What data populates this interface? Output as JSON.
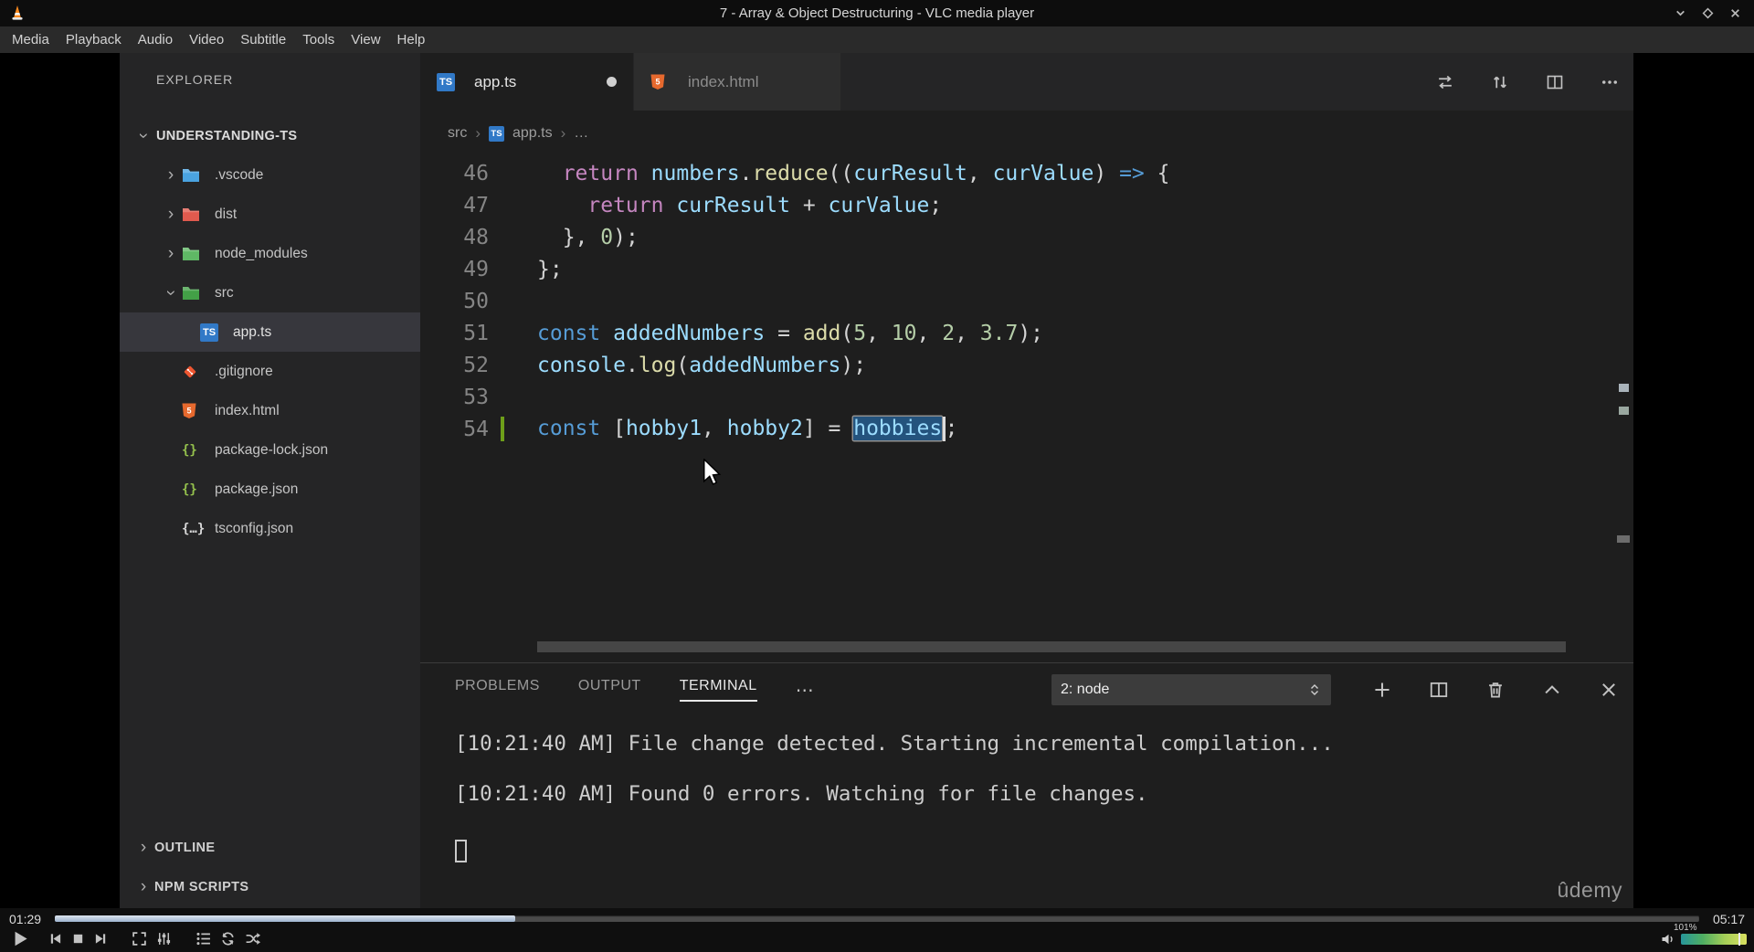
{
  "icons": {
    "chevron": "›",
    "more": "⋯",
    "ts_badge": "TS",
    "html_badge": "5",
    "braces": "{}",
    "braces_dots": "{…}"
  },
  "window": {
    "title": "7 - Array & Object Destructuring - VLC media player"
  },
  "menubar": {
    "items": [
      "Media",
      "Playback",
      "Audio",
      "Video",
      "Subtitle",
      "Tools",
      "View",
      "Help"
    ]
  },
  "player": {
    "elapsed": "01:29",
    "duration": "05:17",
    "progress_pct": 28,
    "volume_pct": "101%"
  },
  "vscode": {
    "explorer": {
      "header": "EXPLORER",
      "root_label": "UNDERSTANDING-TS",
      "items": [
        {
          "label": ".vscode",
          "icon": "folder",
          "color": "#4aa3e0",
          "level": 1,
          "chevron": true
        },
        {
          "label": "dist",
          "icon": "folder",
          "color": "#e05a4e",
          "level": 1,
          "chevron": true
        },
        {
          "label": "node_modules",
          "icon": "folder",
          "color": "#5fb865",
          "level": 1,
          "chevron": true
        },
        {
          "label": "src",
          "icon": "folder",
          "color": "#43a047",
          "level": 1,
          "chevron": true,
          "expanded": true
        },
        {
          "label": "app.ts",
          "icon": "ts",
          "color": "#3179c7",
          "level": 2,
          "selected": true
        },
        {
          "label": ".gitignore",
          "icon": "git",
          "color": "#ee5631",
          "level": 1
        },
        {
          "label": "index.html",
          "icon": "html",
          "color": "#e6692e",
          "level": 1
        },
        {
          "label": "package-lock.json",
          "icon": "json",
          "color": "#95c24d",
          "level": 1
        },
        {
          "label": "package.json",
          "icon": "json",
          "color": "#95c24d",
          "level": 1
        },
        {
          "label": "tsconfig.json",
          "icon": "braces",
          "color": "#d9d9d9",
          "level": 1
        }
      ],
      "sections": [
        "OUTLINE",
        "NPM SCRIPTS"
      ]
    },
    "tabs": [
      {
        "label": "app.ts",
        "icon": "ts",
        "color": "#3179c7",
        "active": true,
        "dirty": true
      },
      {
        "label": "index.html",
        "icon": "html",
        "color": "#e6692e",
        "active": false,
        "dirty": false
      }
    ],
    "breadcrumb": {
      "parts": [
        "src",
        "app.ts",
        "…"
      ]
    },
    "editor": {
      "lines": [
        {
          "num": "46",
          "tokens": [
            {
              "t": "  ",
              "c": "pln"
            },
            {
              "t": "return",
              "c": "ctrl"
            },
            {
              "t": " ",
              "c": "pln"
            },
            {
              "t": "numbers",
              "c": "var"
            },
            {
              "t": ".",
              "c": "pln"
            },
            {
              "t": "reduce",
              "c": "fn"
            },
            {
              "t": "((",
              "c": "pln"
            },
            {
              "t": "curResult",
              "c": "var"
            },
            {
              "t": ", ",
              "c": "pln"
            },
            {
              "t": "curValue",
              "c": "var"
            },
            {
              "t": ") ",
              "c": "pln"
            },
            {
              "t": "=>",
              "c": "kw"
            },
            {
              "t": " {",
              "c": "pln"
            }
          ]
        },
        {
          "num": "47",
          "tokens": [
            {
              "t": "    ",
              "c": "pln"
            },
            {
              "t": "return",
              "c": "ctrl"
            },
            {
              "t": " ",
              "c": "pln"
            },
            {
              "t": "curResult",
              "c": "var"
            },
            {
              "t": " + ",
              "c": "pln"
            },
            {
              "t": "curValue",
              "c": "var"
            },
            {
              "t": ";",
              "c": "pln"
            }
          ]
        },
        {
          "num": "48",
          "tokens": [
            {
              "t": "  }, ",
              "c": "pln"
            },
            {
              "t": "0",
              "c": "num"
            },
            {
              "t": ");",
              "c": "pln"
            }
          ]
        },
        {
          "num": "49",
          "tokens": [
            {
              "t": "};",
              "c": "pln"
            }
          ]
        },
        {
          "num": "50",
          "tokens": []
        },
        {
          "num": "51",
          "tokens": [
            {
              "t": "const",
              "c": "kw"
            },
            {
              "t": " ",
              "c": "pln"
            },
            {
              "t": "addedNumbers",
              "c": "cvar"
            },
            {
              "t": " = ",
              "c": "pln"
            },
            {
              "t": "add",
              "c": "fn"
            },
            {
              "t": "(",
              "c": "pln"
            },
            {
              "t": "5",
              "c": "num"
            },
            {
              "t": ", ",
              "c": "pln"
            },
            {
              "t": "10",
              "c": "num"
            },
            {
              "t": ", ",
              "c": "pln"
            },
            {
              "t": "2",
              "c": "num"
            },
            {
              "t": ", ",
              "c": "pln"
            },
            {
              "t": "3.7",
              "c": "num"
            },
            {
              "t": ");",
              "c": "pln"
            }
          ]
        },
        {
          "num": "52",
          "tokens": [
            {
              "t": "console",
              "c": "var"
            },
            {
              "t": ".",
              "c": "pln"
            },
            {
              "t": "log",
              "c": "fn"
            },
            {
              "t": "(",
              "c": "pln"
            },
            {
              "t": "addedNumbers",
              "c": "cvar"
            },
            {
              "t": ");",
              "c": "pln"
            }
          ]
        },
        {
          "num": "53",
          "tokens": []
        },
        {
          "num": "54",
          "marker": "added",
          "tokens": [
            {
              "t": "const",
              "c": "kw"
            },
            {
              "t": " [",
              "c": "pln"
            },
            {
              "t": "hobby1",
              "c": "var"
            },
            {
              "t": ", ",
              "c": "pln"
            },
            {
              "t": "hobby2",
              "c": "var"
            },
            {
              "t": "] = ",
              "c": "pln"
            },
            {
              "t": "hobbies",
              "c": "var sel"
            },
            {
              "t": "",
              "c": "caret"
            },
            {
              "t": ";",
              "c": "pln"
            }
          ]
        }
      ]
    },
    "panel": {
      "tabs": [
        {
          "label": "PROBLEMS",
          "active": false
        },
        {
          "label": "OUTPUT",
          "active": false
        },
        {
          "label": "TERMINAL",
          "active": true
        }
      ],
      "shell_select": "2: node",
      "terminal_lines": [
        "[10:21:40 AM] File change detected. Starting incremental compilation...",
        "",
        "[10:21:40 AM] Found 0 errors. Watching for file changes.",
        ""
      ]
    },
    "watermark": "ûdemy"
  }
}
